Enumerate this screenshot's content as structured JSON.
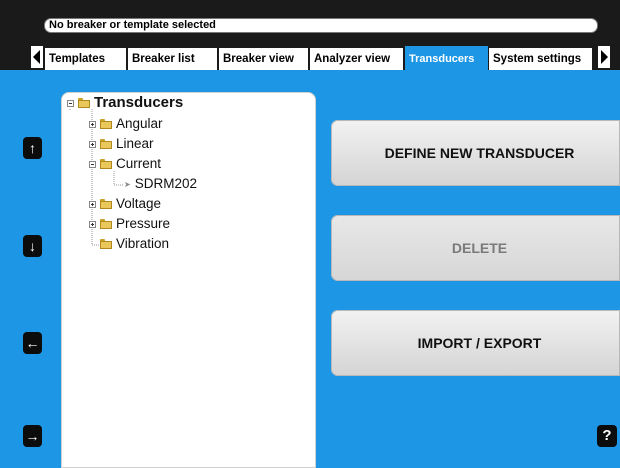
{
  "status": {
    "text": "No breaker or template selected"
  },
  "tabs": [
    {
      "label": "Templates",
      "active": false
    },
    {
      "label": "Breaker list",
      "active": false
    },
    {
      "label": "Breaker view",
      "active": false
    },
    {
      "label": "Analyzer view",
      "active": false
    },
    {
      "label": "Transducers",
      "active": true
    },
    {
      "label": "System settings",
      "active": false
    }
  ],
  "tree": {
    "root": "Transducers",
    "children": [
      {
        "label": "Angular",
        "expanded": false
      },
      {
        "label": "Linear",
        "expanded": false
      },
      {
        "label": "Current",
        "expanded": true,
        "children": [
          "SDRM202"
        ]
      },
      {
        "label": "Voltage",
        "expanded": false
      },
      {
        "label": "Pressure",
        "expanded": false
      },
      {
        "label": "Vibration",
        "expanded": false
      }
    ]
  },
  "side_buttons": {
    "up": "↑",
    "down": "↓",
    "left": "←",
    "right": "→",
    "help": "?"
  },
  "actions": {
    "define": "DEFINE NEW TRANSDUCER",
    "delete": "DELETE",
    "import_export": "IMPORT / EXPORT"
  },
  "colors": {
    "background": "#1e96e6",
    "bar": "#1a1a1a",
    "panel": "#ffffff"
  }
}
